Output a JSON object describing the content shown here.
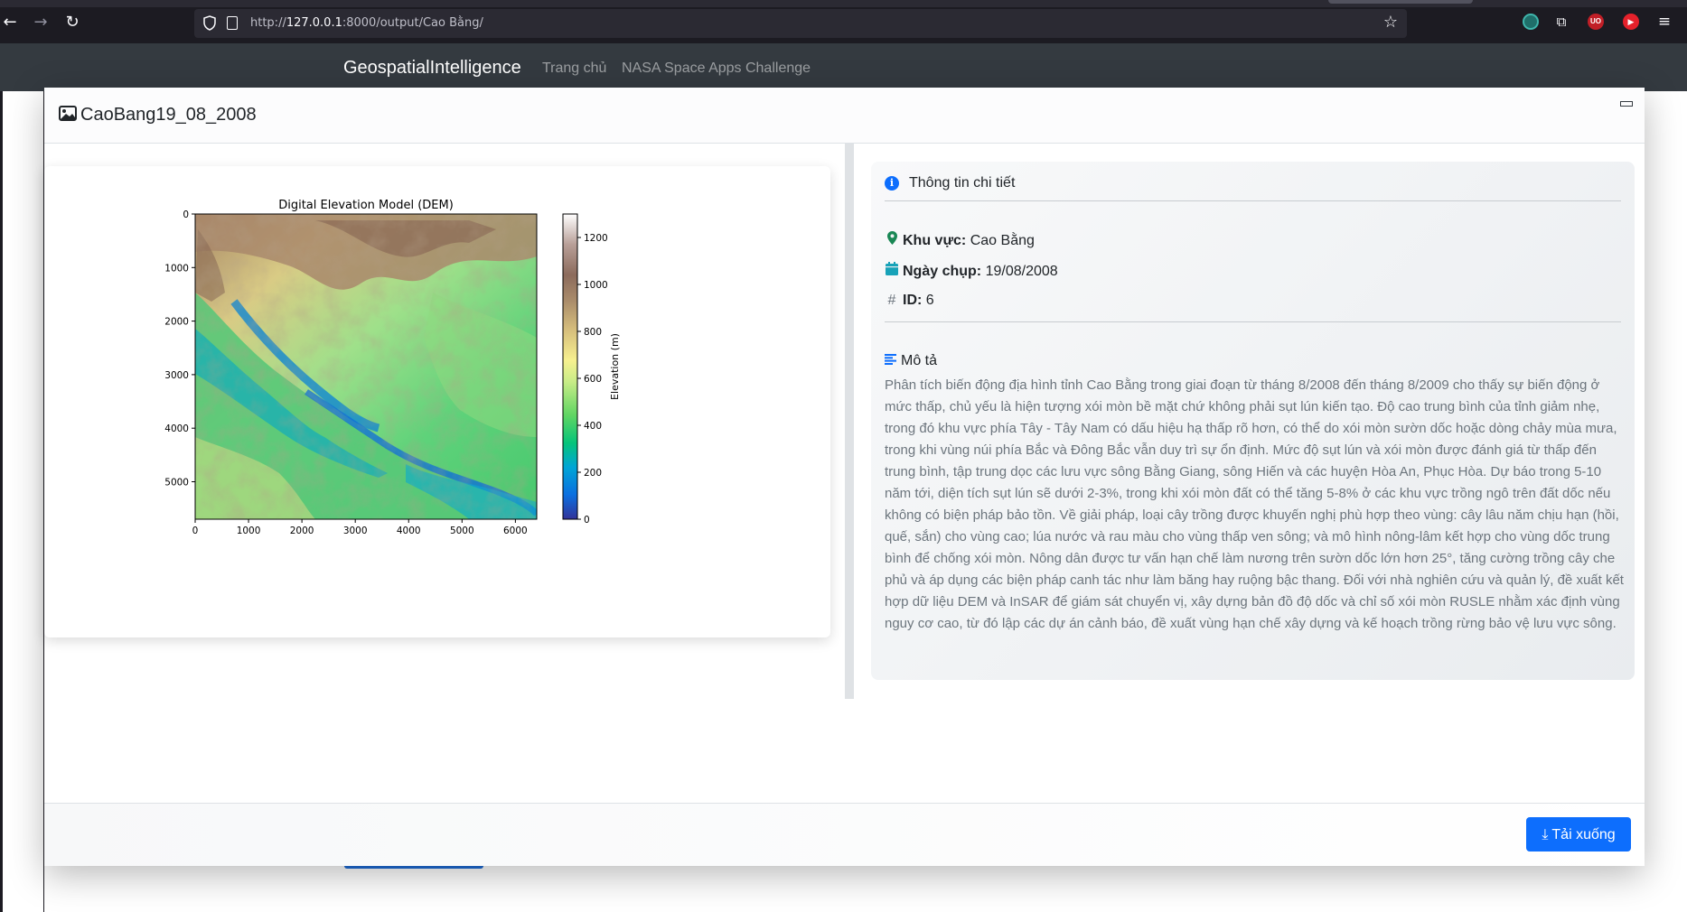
{
  "browser": {
    "url_host": "127.0.0.1",
    "url_prefix": "http://",
    "url_rest": ":8000/output/Cao Bằng/"
  },
  "navbar": {
    "brand": "GeospatialIntelligence",
    "links": [
      "Trang chủ",
      "NASA Space Apps Challenge"
    ]
  },
  "modal": {
    "title": "CaoBang19_08_2008",
    "info": {
      "heading": "Thông tin chi tiết",
      "region_label": "Khu vực:",
      "region_value": "Cao Bằng",
      "date_label": "Ngày chụp:",
      "date_value": "19/08/2008",
      "id_label": "ID:",
      "id_value": "6",
      "desc_heading": "Mô tả",
      "description": "Phân tích biến động địa hình tỉnh Cao Bằng trong giai đoạn từ tháng 8/2008 đến tháng 8/2009 cho thấy sự biến động ở mức thấp, chủ yếu là hiện tượng xói mòn bề mặt chứ không phải sụt lún kiến tạo. Độ cao trung bình của tỉnh giảm nhẹ, trong đó khu vực phía Tây - Tây Nam có dấu hiệu hạ thấp rõ hơn, có thể do xói mòn sườn dốc hoặc dòng chảy mùa mưa, trong khi vùng núi phía Bắc và Đông Bắc vẫn duy trì sự ổn định. Mức độ sụt lún và xói mòn được đánh giá từ thấp đến trung bình, tập trung dọc các lưu vực sông Bằng Giang, sông Hiến và các huyện Hòa An, Phục Hòa. Dự báo trong 5-10 năm tới, diện tích sụt lún sẽ dưới 2-3%, trong khi xói mòn đất có thể tăng 5-8% ở các khu vực trồng ngô trên đất dốc nếu không có biện pháp bảo tồn. Về giải pháp, loại cây trồng được khuyến nghị phù hợp theo vùng: cây lâu năm chịu hạn (hồi, quế, sắn) cho vùng cao; lúa nước và rau màu cho vùng thấp ven sông; và mô hình nông-lâm kết hợp cho vùng dốc trung bình để chống xói mòn. Nông dân được tư vấn hạn chế làm nương trên sườn dốc lớn hơn 25°, tăng cường trồng cây che phủ và áp dụng các biện pháp canh tác như làm băng hay ruộng bậc thang. Đối với nhà nghiên cứu và quản lý, đề xuất kết hợp dữ liệu DEM và InSAR để giám sát chuyển vị, xây dựng bản đồ độ dốc và chỉ số xói mòn RUSLE nhằm xác định vùng nguy cơ cao, từ đó lập các dự án cảnh báo, đề xuất vùng hạn chế xây dựng và kế hoạch trồng rừng bảo vệ lưu vực sông."
    },
    "download_label": "Tải xuống"
  },
  "chart_data": {
    "type": "heatmap",
    "title": "Digital Elevation Model (DEM)",
    "x_ticks": [
      0,
      1000,
      2000,
      3000,
      4000,
      5000,
      6000
    ],
    "y_ticks": [
      0,
      1000,
      2000,
      3000,
      4000,
      5000
    ],
    "xlim": [
      0,
      6400
    ],
    "ylim": [
      5700,
      0
    ],
    "colorbar": {
      "label": "Elevation (m)",
      "ticks": [
        0,
        200,
        400,
        600,
        800,
        1000,
        1200
      ],
      "range": [
        0,
        1300
      ],
      "colormap": "terrain"
    },
    "colors": {
      "low": "#3333cc",
      "mid_low": "#00b2b2",
      "mid": "#33cc66",
      "mid_high": "#f0ee8e",
      "high": "#8a6a55",
      "top": "#ffffff"
    }
  }
}
